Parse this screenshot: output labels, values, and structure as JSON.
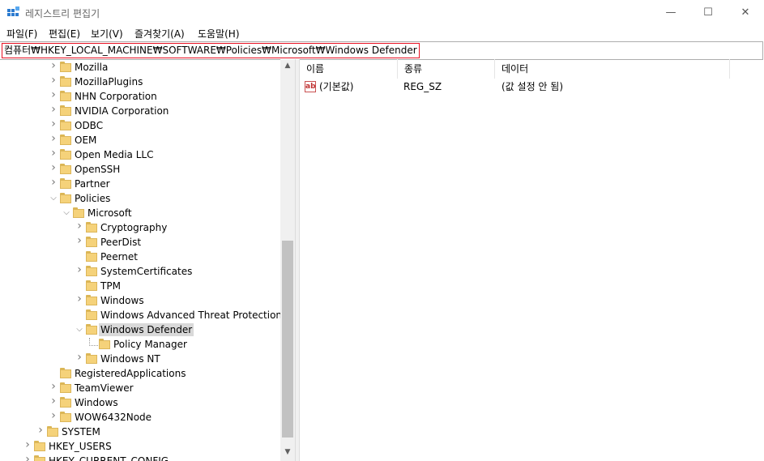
{
  "window": {
    "title": "레지스트리 편집기",
    "minimize": "—",
    "maximize": "☐",
    "close": "✕"
  },
  "menu": [
    "파일(F)",
    "편집(E)",
    "보기(V)",
    "즐겨찾기(A)",
    "도움말(H)"
  ],
  "address": "컴퓨터₩HKEY_LOCAL_MACHINE₩SOFTWARE₩Policies₩Microsoft₩Windows Defender",
  "tree": [
    {
      "label": "Mozilla",
      "level": 2,
      "expander": "collapsed"
    },
    {
      "label": "MozillaPlugins",
      "level": 2,
      "expander": "collapsed"
    },
    {
      "label": "NHN Corporation",
      "level": 2,
      "expander": "collapsed"
    },
    {
      "label": "NVIDIA Corporation",
      "level": 2,
      "expander": "collapsed"
    },
    {
      "label": "ODBC",
      "level": 2,
      "expander": "collapsed"
    },
    {
      "label": "OEM",
      "level": 2,
      "expander": "collapsed"
    },
    {
      "label": "Open Media LLC",
      "level": 2,
      "expander": "collapsed"
    },
    {
      "label": "OpenSSH",
      "level": 2,
      "expander": "collapsed"
    },
    {
      "label": "Partner",
      "level": 2,
      "expander": "collapsed"
    },
    {
      "label": "Policies",
      "level": 2,
      "expander": "expanded"
    },
    {
      "label": "Microsoft",
      "level": 3,
      "expander": "expanded"
    },
    {
      "label": "Cryptography",
      "level": 4,
      "expander": "collapsed"
    },
    {
      "label": "PeerDist",
      "level": 4,
      "expander": "collapsed"
    },
    {
      "label": "Peernet",
      "level": 4,
      "expander": "none"
    },
    {
      "label": "SystemCertificates",
      "level": 4,
      "expander": "collapsed"
    },
    {
      "label": "TPM",
      "level": 4,
      "expander": "none"
    },
    {
      "label": "Windows",
      "level": 4,
      "expander": "collapsed"
    },
    {
      "label": "Windows Advanced Threat Protection",
      "level": 4,
      "expander": "none"
    },
    {
      "label": "Windows Defender",
      "level": 4,
      "expander": "expanded",
      "selected": true
    },
    {
      "label": "Policy Manager",
      "level": 5,
      "expander": "none"
    },
    {
      "label": "Windows NT",
      "level": 4,
      "expander": "collapsed"
    },
    {
      "label": "RegisteredApplications",
      "level": 2,
      "expander": "none"
    },
    {
      "label": "TeamViewer",
      "level": 2,
      "expander": "collapsed"
    },
    {
      "label": "Windows",
      "level": 2,
      "expander": "collapsed"
    },
    {
      "label": "WOW6432Node",
      "level": 2,
      "expander": "collapsed"
    },
    {
      "label": "SYSTEM",
      "level": 1,
      "expander": "collapsed"
    },
    {
      "label": "HKEY_USERS",
      "level": 0,
      "expander": "collapsed"
    },
    {
      "label": "HKEY_CURRENT_CONFIG",
      "level": 0,
      "expander": "collapsed"
    }
  ],
  "list": {
    "columns": [
      "이름",
      "종류",
      "데이터"
    ],
    "rows": [
      {
        "icon": "ab",
        "name": "(기본값)",
        "type": "REG_SZ",
        "data": "(값 설정 안 됨)"
      }
    ]
  },
  "colors": {
    "address_highlight": "#e81123",
    "folder": "#f5d27a",
    "selection": "#d9d9d9"
  }
}
